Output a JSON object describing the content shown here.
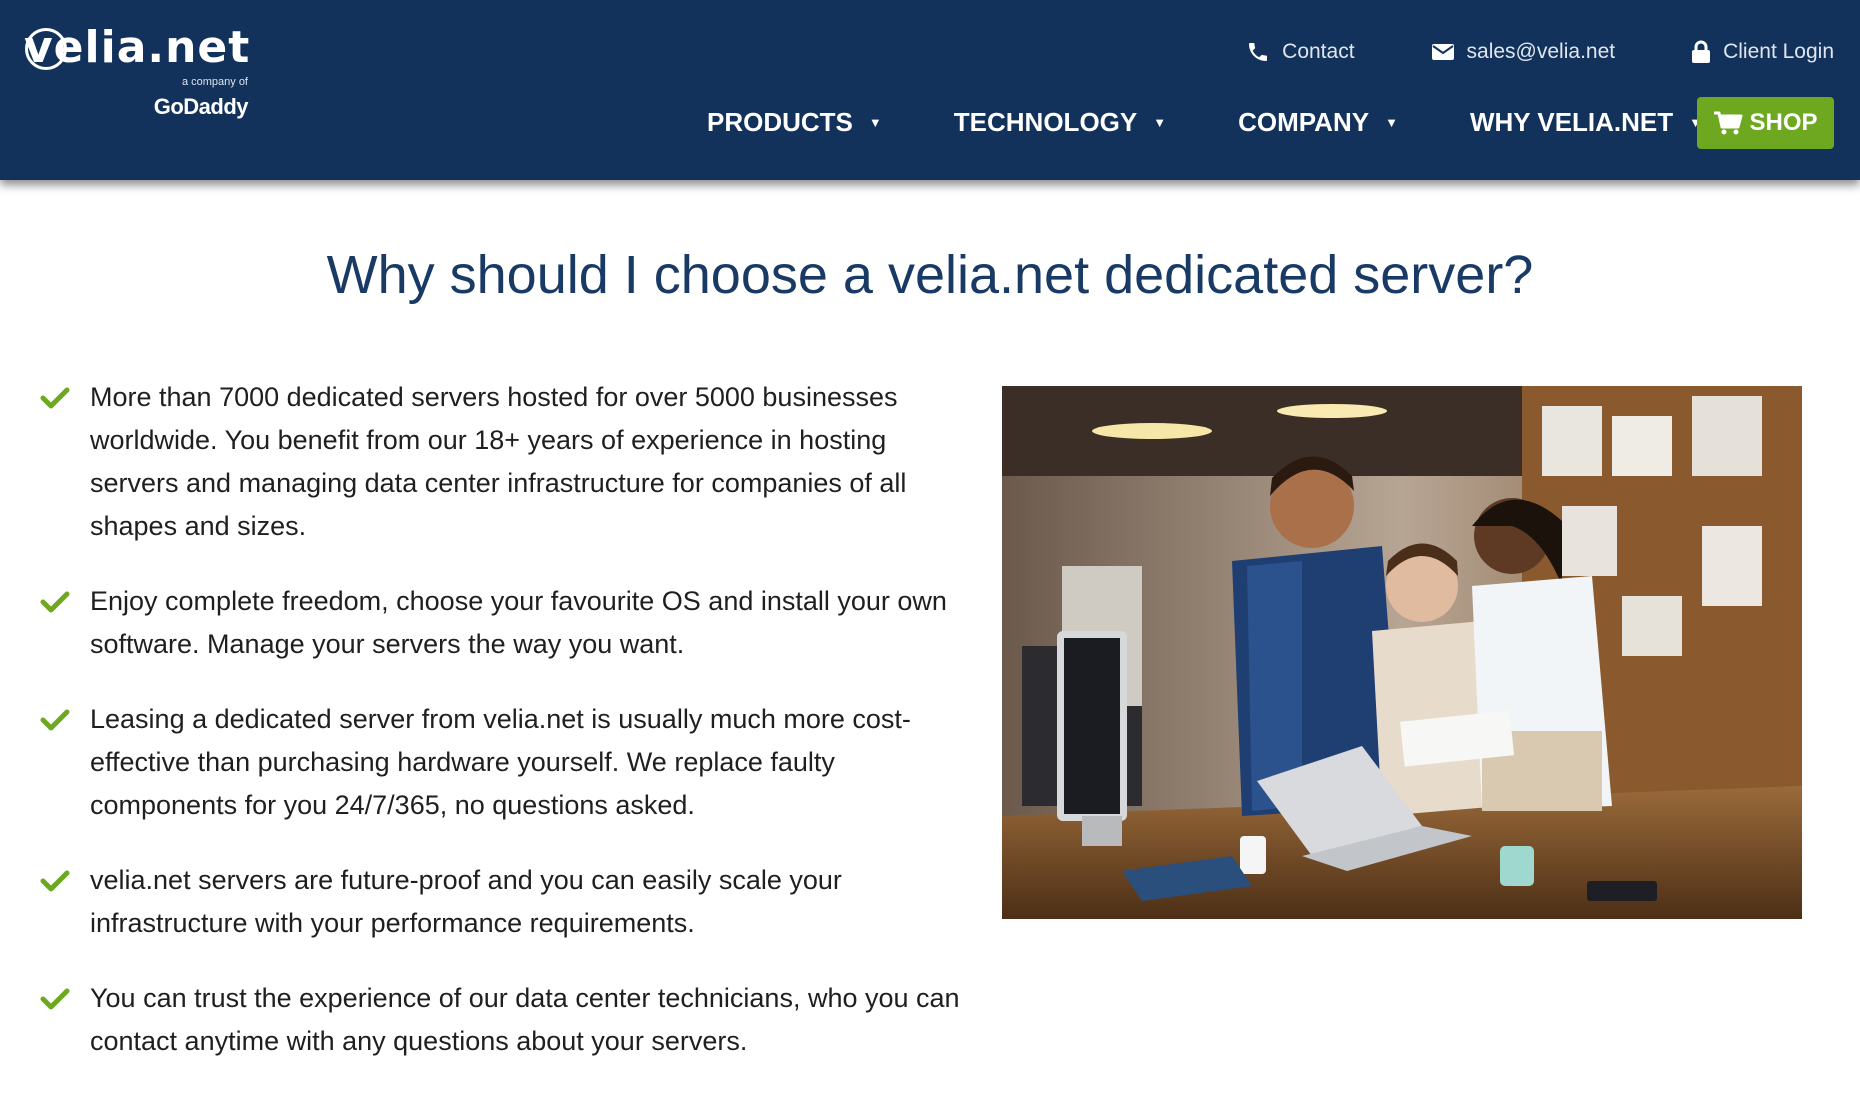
{
  "header": {
    "logo": {
      "wordmark": "velia.net",
      "tagline": "a company of",
      "parent_brand": "GoDaddy"
    },
    "topbar": {
      "contact_label": "Contact",
      "email_label": "sales@velia.net",
      "login_label": "Client Login"
    },
    "nav": {
      "items": [
        {
          "label": "PRODUCTS",
          "icon": "caret-down-icon"
        },
        {
          "label": "TECHNOLOGY",
          "icon": "caret-down-icon"
        },
        {
          "label": "COMPANY",
          "icon": "caret-down-icon"
        },
        {
          "label": "WHY VELIA.NET",
          "icon": "caret-down-icon"
        }
      ],
      "shop_label": "SHOP"
    }
  },
  "main": {
    "title": "Why should I choose a velia.net dedicated server?",
    "features": [
      "More than 7000 dedicated servers hosted for over 5000 businesses worldwide. You benefit from our 18+ years of experience in hosting servers and managing data center infrastructure for companies of all shapes and sizes.",
      "Enjoy complete freedom, choose your favourite OS and install your own software. Manage your servers the way you want.",
      "Leasing a dedicated server from velia.net is usually much more cost-effective than purchasing hardware yourself. We replace faulty components for you 24/7/365, no questions asked.",
      "velia.net servers are future-proof and you can easily scale your infrastructure with your performance requirements.",
      "You can trust the experience of our data center technicians, who you can contact anytime with any questions about your servers."
    ]
  },
  "colors": {
    "header_bg": "#13325b",
    "title_text": "#1a3a66",
    "accent_green": "#6ea820",
    "body_text": "#1f1f1f"
  },
  "icons": {
    "contact": "phone-icon",
    "email": "envelope-icon",
    "login": "lock-icon",
    "shop": "cart-icon",
    "bullet": "checkmark-icon"
  }
}
